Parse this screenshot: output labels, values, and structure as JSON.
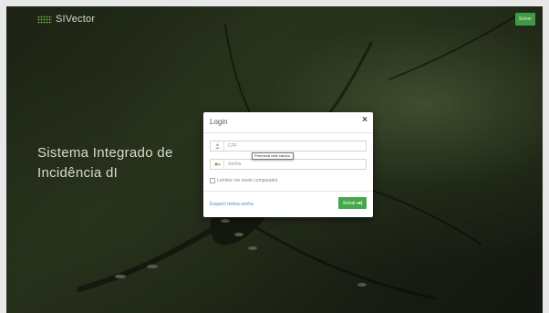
{
  "brand": {
    "name": "SIVector",
    "logo_icon": "grid-dots-icon",
    "logo_color": "#5f9f3e"
  },
  "topbar": {
    "enter_label": "Entrar"
  },
  "hero": {
    "line1": "Sistema Integrado de",
    "line2": "Incidência dI"
  },
  "login_modal": {
    "title": "Login",
    "close_glyph": "×",
    "cpf": {
      "placeholder": "CPF",
      "icon": "user-icon"
    },
    "password": {
      "placeholder": "Senha",
      "icon": "key-icon"
    },
    "validation_tooltip": "Preencha este campo.",
    "remember_label": "Lembre me neste computador",
    "forgot_label": "Esqueci minha senha",
    "submit_label": "Entrar",
    "submit_icon": "sign-in-icon",
    "accent_color": "#45a84a"
  }
}
